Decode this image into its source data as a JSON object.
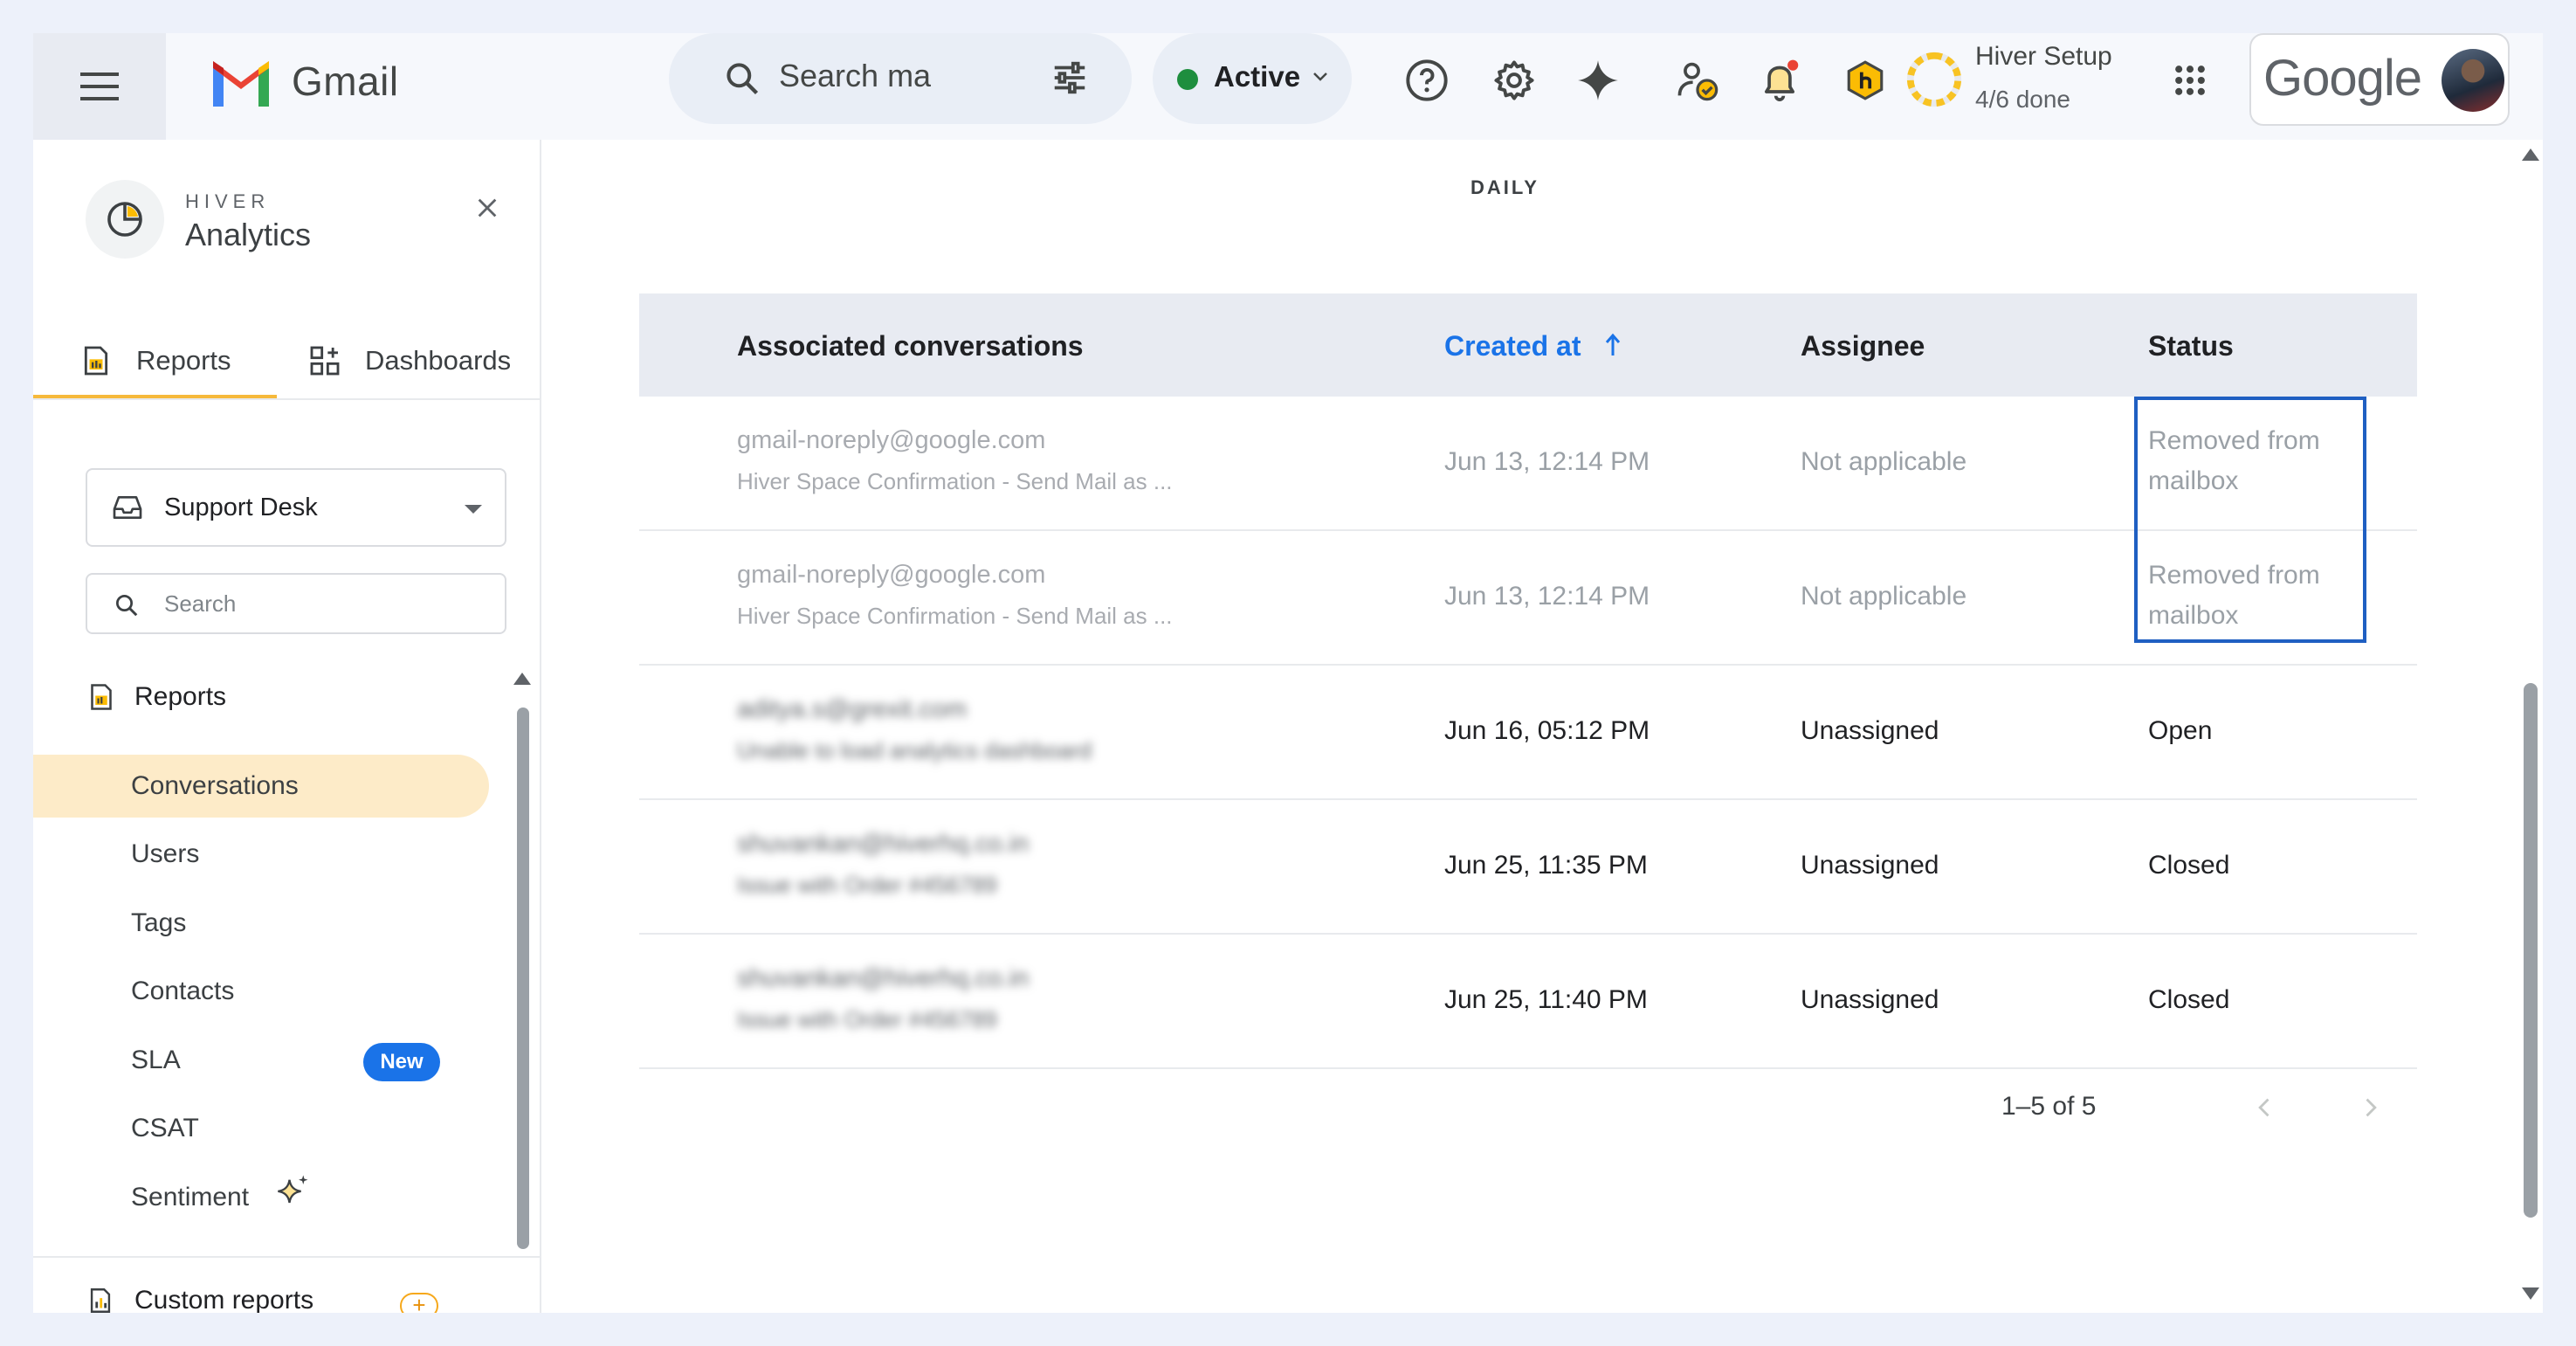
{
  "header": {
    "app_name": "Gmail",
    "search_placeholder": "Search ma",
    "status_label": "Active",
    "setup_title": "Hiver Setup",
    "setup_progress": "4/6 done",
    "setup_progress_fraction": 0.667,
    "account_brand": "Google"
  },
  "sidebar": {
    "brand": "HIVER",
    "product": "Analytics",
    "tabs": [
      {
        "label": "Reports",
        "active": true
      },
      {
        "label": "Dashboards",
        "active": false
      }
    ],
    "inbox_select": "Support Desk",
    "search_placeholder": "Search",
    "section_title": "Reports",
    "items": [
      {
        "label": "Conversations",
        "active": true
      },
      {
        "label": "Users"
      },
      {
        "label": "Tags"
      },
      {
        "label": "Contacts"
      },
      {
        "label": "SLA",
        "badge": "New"
      },
      {
        "label": "CSAT"
      },
      {
        "label": "Sentiment"
      }
    ],
    "custom_reports": "Custom reports"
  },
  "main": {
    "period_label": "DAILY",
    "table": {
      "columns": [
        {
          "label": "Associated conversations"
        },
        {
          "label": "Created at",
          "sorted": "asc"
        },
        {
          "label": "Assignee"
        },
        {
          "label": "Status"
        }
      ],
      "rows": [
        {
          "email": "gmail-noreply@google.com",
          "subject": "Hiver Space Confirmation - Send Mail as ...",
          "created": "Jun 13, 12:14 PM",
          "assignee": "Not applicable",
          "status_line1": "Removed from",
          "status_line2": "mailbox",
          "muted": true
        },
        {
          "email": "gmail-noreply@google.com",
          "subject": "Hiver Space Confirmation - Send Mail as ...",
          "created": "Jun 13, 12:14 PM",
          "assignee": "Not applicable",
          "status_line1": "Removed from",
          "status_line2": "mailbox",
          "muted": true
        },
        {
          "email": "aditya.s@grexit.com",
          "subject": "Unable to load analytics dashboard",
          "created": "Jun 16, 05:12 PM",
          "assignee": "Unassigned",
          "status_line1": "Open",
          "status_line2": "",
          "blurred": true
        },
        {
          "email": "shuvankan@hiverhq.co.in",
          "subject": "Issue with Order #456789",
          "created": "Jun 25, 11:35 PM",
          "assignee": "Unassigned",
          "status_line1": "Closed",
          "status_line2": "",
          "blurred": true
        },
        {
          "email": "shuvankan@hiverhq.co.in",
          "subject": "Issue with Order #456789",
          "created": "Jun 25, 11:40 PM",
          "assignee": "Unassigned",
          "status_line1": "Closed",
          "status_line2": "",
          "blurred": true
        }
      ]
    },
    "pagination": "1–5 of 5"
  },
  "colors": {
    "accent_blue": "#1a73e8",
    "highlight_border": "#1f5fc2",
    "active_nav_bg": "#fdebc8",
    "tab_underline": "#f6b93b",
    "status_green": "#1e8e3e"
  }
}
